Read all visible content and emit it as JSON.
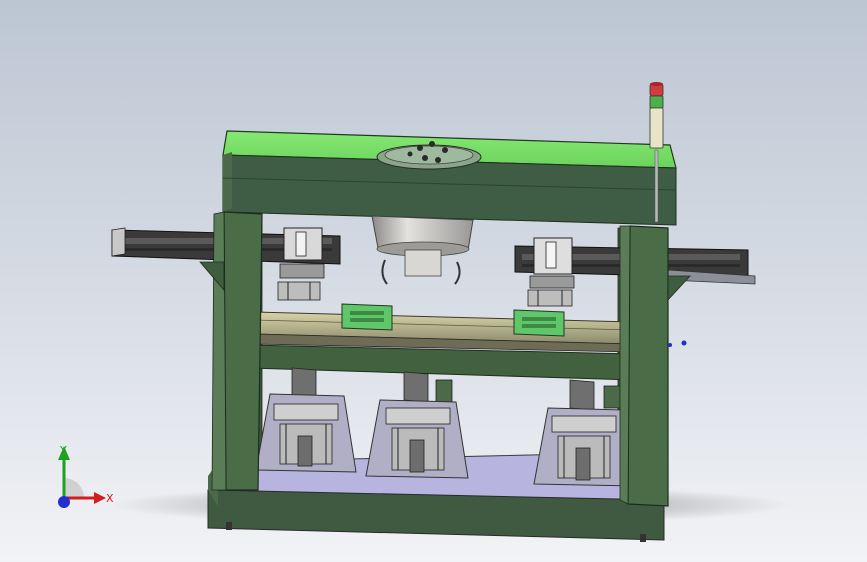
{
  "viewport": {
    "background_top": "#bcc6d3",
    "background_bottom": "#f2f3f6"
  },
  "model": {
    "frame_color": "#4d6b4a",
    "top_plate_color": "#7be06a",
    "base_plate_color": "#b8b6e0",
    "slide_plate_color": "#5cc06a",
    "signal_tower_colors": [
      "#d33c3c",
      "#4bb04b",
      "#e8e4c8"
    ]
  },
  "triad": {
    "x_label": "X",
    "y_label": "Y",
    "x_color": "#d11f1f",
    "y_color": "#1fa01f",
    "z_color": "#1f2fd1"
  }
}
